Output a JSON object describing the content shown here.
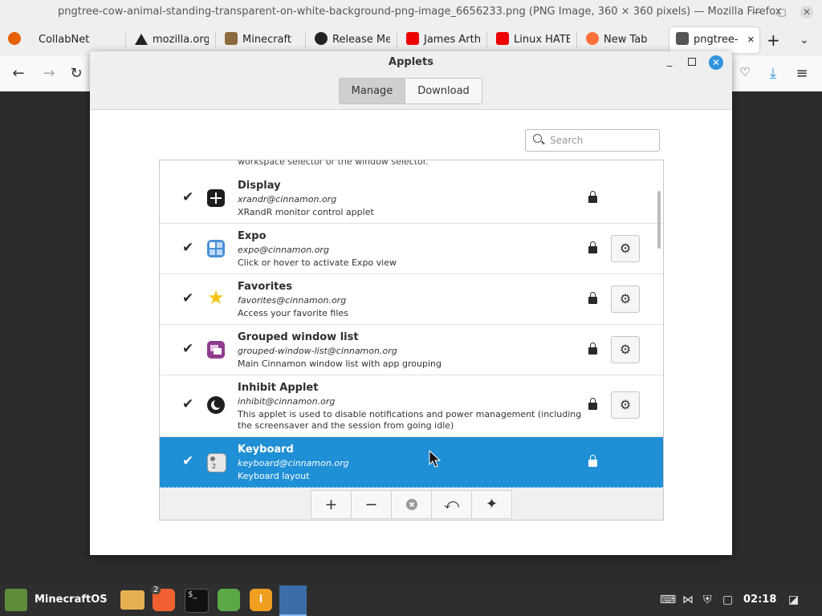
{
  "firefox": {
    "window_title": "pngtree-cow-animal-standing-transparent-on-white-background-png-image_6656233.png (PNG Image, 360 × 360 pixels) — Mozilla Firefox",
    "tabs": [
      {
        "label": "CollabNet",
        "icon": "firefox-icon"
      },
      {
        "label": "mozilla.org",
        "icon": "warning-icon"
      },
      {
        "label": "Minecraft",
        "icon": "minecraft-icon"
      },
      {
        "label": "Release Me",
        "icon": "github-icon"
      },
      {
        "label": "James Arth",
        "icon": "youtube-icon"
      },
      {
        "label": "Linux HATE",
        "icon": "youtube-icon"
      },
      {
        "label": "New Tab",
        "icon": "firefox-icon"
      },
      {
        "label": "pngtree-",
        "icon": "image-icon"
      }
    ]
  },
  "dialog": {
    "title": "Applets",
    "tabs": {
      "manage": "Manage",
      "download": "Download"
    },
    "search_placeholder": "Search",
    "cut_row_text": "workspace selector or the window selector.",
    "applets": [
      {
        "name": "Display",
        "uuid": "xrandr@cinnamon.org",
        "desc": "XRandR monitor control applet",
        "checked": true,
        "configurable": false
      },
      {
        "name": "Expo",
        "uuid": "expo@cinnamon.org",
        "desc": "Click or hover to activate Expo view",
        "checked": true,
        "configurable": true
      },
      {
        "name": "Favorites",
        "uuid": "favorites@cinnamon.org",
        "desc": "Access your favorite files",
        "checked": true,
        "configurable": true
      },
      {
        "name": "Grouped window list",
        "uuid": "grouped-window-list@cinnamon.org",
        "desc": "Main Cinnamon window list with app grouping",
        "checked": true,
        "configurable": true
      },
      {
        "name": "Inhibit Applet",
        "uuid": "inhibit@cinnamon.org",
        "desc": "This applet is used to disable notifications and power management (including the screensaver and the session from going idle)",
        "checked": true,
        "configurable": true
      },
      {
        "name": "Keyboard",
        "uuid": "keyboard@cinnamon.org",
        "desc": "Keyboard layout",
        "checked": true,
        "configurable": false,
        "selected": true
      }
    ]
  },
  "taskbar": {
    "menu_label": "MinecraftOS",
    "badge_count": "2",
    "clock": "02:18"
  },
  "colors": {
    "selection": "#1f8fd6",
    "close_button": "#2f93dd"
  }
}
